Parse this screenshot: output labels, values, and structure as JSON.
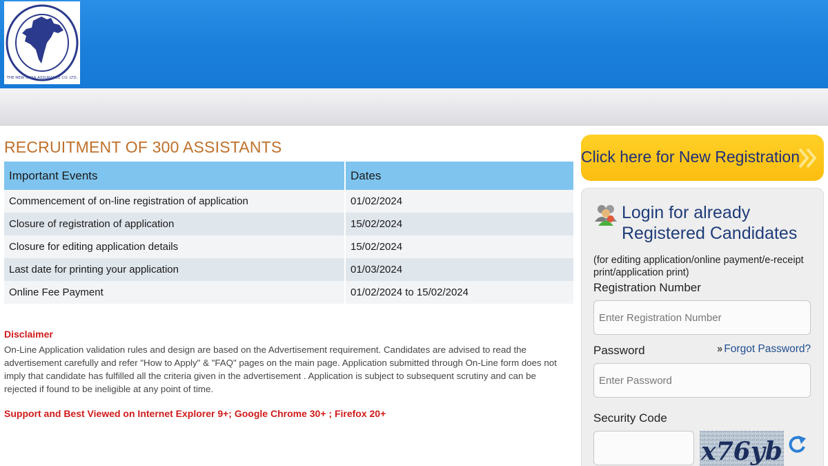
{
  "page": {
    "title": "RECRUITMENT OF 300 ASSISTANTS"
  },
  "colors": {
    "header_blue": "#1a7fda",
    "title_orange": "#c0702a",
    "table_header": "#7ec4ee",
    "alert_red": "#d01a1a",
    "button_yellow": "#fbbd10",
    "login_blue": "#1f3c7a"
  },
  "logo": {
    "icon": "new-india-assurance-logo",
    "text": "THE NEW INDIA ASSURANCE CO. LTD."
  },
  "events_table": {
    "headers": [
      "Important Events",
      "Dates"
    ],
    "rows": [
      {
        "event": "Commencement of on-line registration of application",
        "date": "01/02/2024"
      },
      {
        "event": "Closure of registration of application",
        "date": "15/02/2024"
      },
      {
        "event": "Closure for editing application details",
        "date": "15/02/2024"
      },
      {
        "event": "Last date for printing your application",
        "date": "01/03/2024"
      },
      {
        "event": "Online Fee Payment",
        "date": "01/02/2024 to 15/02/2024"
      }
    ]
  },
  "disclaimer": {
    "title": "Disclaimer",
    "text": "On-Line Application validation rules and design are based on the Advertisement requirement. Candidates are advised to read the advertisement carefully and refer \"How to Apply\" & \"FAQ\" pages on the main page. Application submitted through On-Line form does not imply that candidate has fulfilled all the criteria given in the advertisement . Application is subject to subsequent scrutiny and can be rejected if found to be ineligible at any point of time."
  },
  "support_text": "Support and Best Viewed on Internet Explorer 9+; Google Chrome 30+ ; Firefox 20+",
  "registration": {
    "button_label": "Click here for New Registration",
    "icon": "double-chevron-right-icon"
  },
  "login": {
    "icon": "users-icon",
    "title": "Login for already Registered Candidates",
    "subtitle": "(for editing application/online payment/e-receipt print/application print)",
    "registration_label": "Registration Number",
    "registration_placeholder": "Enter Registration Number",
    "registration_value": "",
    "password_label": "Password",
    "password_placeholder": "Enter Password",
    "password_value": "",
    "forgot_label": "Forgot Password?",
    "security_label": "Security Code",
    "security_value": "",
    "captcha_text": "x76yb",
    "refresh_icon": "refresh-icon"
  }
}
